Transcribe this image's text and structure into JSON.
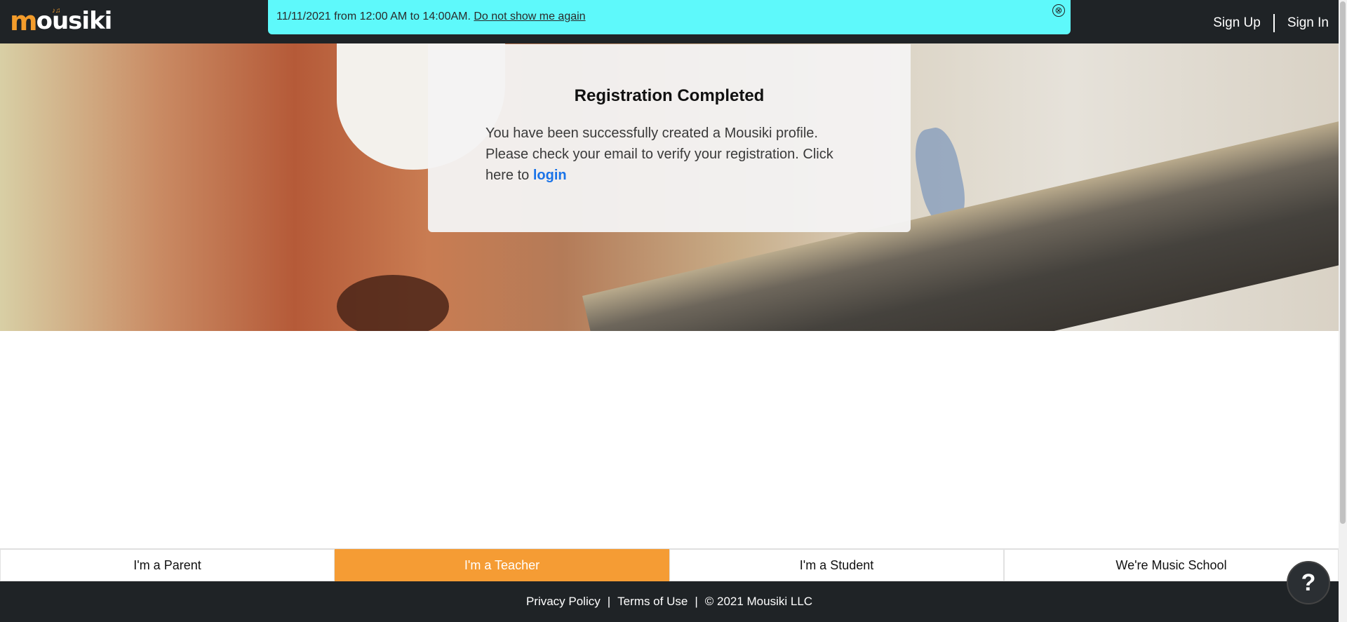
{
  "header": {
    "logo_text_first": "m",
    "logo_text_rest": "ousiki",
    "logo_note": "♪♫",
    "sign_up": "Sign Up",
    "sign_in": "Sign In"
  },
  "notice": {
    "message": "11/11/2021 from 12:00 AM to 14:00AM.",
    "dismiss_link": "Do not show me again",
    "close_icon": "⊗"
  },
  "card": {
    "title": "Registration Completed",
    "body": "You have been successfully created a Mousiki profile. Please check your email to verify your registration. Click here to",
    "login_link": "login"
  },
  "roles": [
    {
      "label": "I'm a Parent",
      "active": false
    },
    {
      "label": "I'm a Teacher",
      "active": true
    },
    {
      "label": "I'm a Student",
      "active": false
    },
    {
      "label": "We're Music School",
      "active": false
    }
  ],
  "footer": {
    "privacy": "Privacy Policy",
    "terms": "Terms of Use",
    "copyright": "© 2021 Mousiki LLC",
    "separator": "|"
  },
  "help": {
    "label": "?"
  },
  "colors": {
    "accent": "#f59c34",
    "dark": "#1f2326",
    "banner": "#5ef9fb",
    "link": "#1a73e8"
  }
}
